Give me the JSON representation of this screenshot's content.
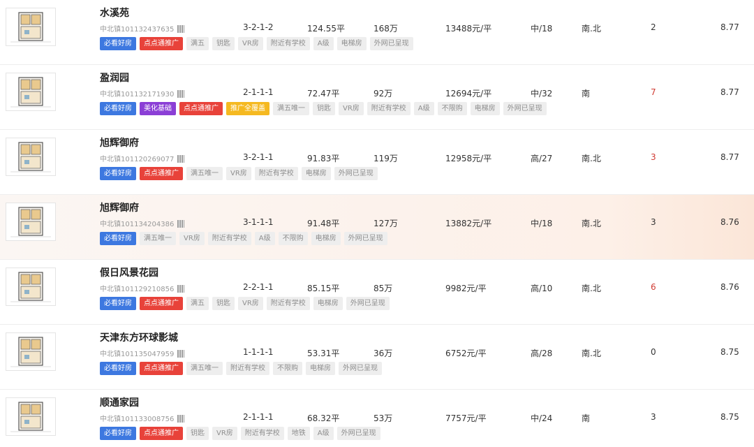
{
  "listings": [
    {
      "name": "水溪苑",
      "code": "中北镇101132437635",
      "layout": "3-2-1-2",
      "area": "124.55平",
      "total_price": "168万",
      "unit_price": "13488元/平",
      "floor": "中/18",
      "orientation": "南.北",
      "count": "2",
      "count_highlight": false,
      "score": "8.77",
      "highlighted": false,
      "tags": [
        {
          "text": "必看好房",
          "color": "blue"
        },
        {
          "text": "点点通推广",
          "color": "red"
        },
        {
          "text": "满五",
          "color": "gray"
        },
        {
          "text": "钥匙",
          "color": "gray"
        },
        {
          "text": "VR房",
          "color": "gray"
        },
        {
          "text": "附近有学校",
          "color": "gray"
        },
        {
          "text": "A级",
          "color": "gray"
        },
        {
          "text": "电梯房",
          "color": "gray"
        },
        {
          "text": "外网已呈现",
          "color": "gray"
        }
      ]
    },
    {
      "name": "盈润园",
      "code": "中北镇101132171930",
      "layout": "2-1-1-1",
      "area": "72.47平",
      "total_price": "92万",
      "unit_price": "12694元/平",
      "floor": "中/32",
      "orientation": "南",
      "count": "7",
      "count_highlight": true,
      "score": "8.77",
      "highlighted": false,
      "tags": [
        {
          "text": "必看好房",
          "color": "blue"
        },
        {
          "text": "美化基础",
          "color": "purple"
        },
        {
          "text": "点点通推广",
          "color": "red"
        },
        {
          "text": "推广全覆盖",
          "color": "yellow"
        },
        {
          "text": "满五唯一",
          "color": "gray"
        },
        {
          "text": "钥匙",
          "color": "gray"
        },
        {
          "text": "VR房",
          "color": "gray"
        },
        {
          "text": "附近有学校",
          "color": "gray"
        },
        {
          "text": "A级",
          "color": "gray"
        },
        {
          "text": "不限购",
          "color": "gray"
        },
        {
          "text": "电梯房",
          "color": "gray"
        },
        {
          "text": "外网已呈现",
          "color": "gray"
        }
      ]
    },
    {
      "name": "旭辉御府",
      "code": "中北镇101120269077",
      "layout": "3-2-1-1",
      "area": "91.83平",
      "total_price": "119万",
      "unit_price": "12958元/平",
      "floor": "高/27",
      "orientation": "南.北",
      "count": "3",
      "count_highlight": true,
      "score": "8.77",
      "highlighted": false,
      "tags": [
        {
          "text": "必看好房",
          "color": "blue"
        },
        {
          "text": "点点通推广",
          "color": "red"
        },
        {
          "text": "满五唯一",
          "color": "gray"
        },
        {
          "text": "VR房",
          "color": "gray"
        },
        {
          "text": "附近有学校",
          "color": "gray"
        },
        {
          "text": "电梯房",
          "color": "gray"
        },
        {
          "text": "外网已呈现",
          "color": "gray"
        }
      ]
    },
    {
      "name": "旭辉御府",
      "code": "中北镇101134204386",
      "layout": "3-1-1-1",
      "area": "91.48平",
      "total_price": "127万",
      "unit_price": "13882元/平",
      "floor": "中/18",
      "orientation": "南.北",
      "count": "3",
      "count_highlight": false,
      "score": "8.76",
      "highlighted": true,
      "tags": [
        {
          "text": "必看好房",
          "color": "blue"
        },
        {
          "text": "满五唯一",
          "color": "gray"
        },
        {
          "text": "VR房",
          "color": "gray"
        },
        {
          "text": "附近有学校",
          "color": "gray"
        },
        {
          "text": "A级",
          "color": "gray"
        },
        {
          "text": "不限购",
          "color": "gray"
        },
        {
          "text": "电梯房",
          "color": "gray"
        },
        {
          "text": "外网已呈现",
          "color": "gray"
        }
      ]
    },
    {
      "name": "假日风景花园",
      "code": "中北镇101129210856",
      "layout": "2-2-1-1",
      "area": "85.15平",
      "total_price": "85万",
      "unit_price": "9982元/平",
      "floor": "高/10",
      "orientation": "南.北",
      "count": "6",
      "count_highlight": true,
      "score": "8.76",
      "highlighted": false,
      "tags": [
        {
          "text": "必看好房",
          "color": "blue"
        },
        {
          "text": "点点通推广",
          "color": "red"
        },
        {
          "text": "满五",
          "color": "gray"
        },
        {
          "text": "钥匙",
          "color": "gray"
        },
        {
          "text": "VR房",
          "color": "gray"
        },
        {
          "text": "附近有学校",
          "color": "gray"
        },
        {
          "text": "电梯房",
          "color": "gray"
        },
        {
          "text": "外网已呈现",
          "color": "gray"
        }
      ]
    },
    {
      "name": "天津东方环球影城",
      "code": "中北镇101135047959",
      "layout": "1-1-1-1",
      "area": "53.31平",
      "total_price": "36万",
      "unit_price": "6752元/平",
      "floor": "高/28",
      "orientation": "南.北",
      "count": "0",
      "count_highlight": false,
      "score": "8.75",
      "highlighted": false,
      "tags": [
        {
          "text": "必看好房",
          "color": "blue"
        },
        {
          "text": "点点通推广",
          "color": "red"
        },
        {
          "text": "满五唯一",
          "color": "gray"
        },
        {
          "text": "附近有学校",
          "color": "gray"
        },
        {
          "text": "不限购",
          "color": "gray"
        },
        {
          "text": "电梯房",
          "color": "gray"
        },
        {
          "text": "外网已呈现",
          "color": "gray"
        }
      ]
    },
    {
      "name": "顺通家园",
      "code": "中北镇101133008756",
      "layout": "2-1-1-1",
      "area": "68.32平",
      "total_price": "53万",
      "unit_price": "7757元/平",
      "floor": "中/24",
      "orientation": "南",
      "count": "3",
      "count_highlight": false,
      "score": "8.75",
      "highlighted": false,
      "tags": [
        {
          "text": "必看好房",
          "color": "blue"
        },
        {
          "text": "点点通推广",
          "color": "red"
        },
        {
          "text": "钥匙",
          "color": "gray"
        },
        {
          "text": "VR房",
          "color": "gray"
        },
        {
          "text": "附近有学校",
          "color": "gray"
        },
        {
          "text": "地铁",
          "color": "gray"
        },
        {
          "text": "A级",
          "color": "gray"
        },
        {
          "text": "外网已呈现",
          "color": "gray"
        }
      ]
    }
  ],
  "colors": {
    "blue": "#3d78e0",
    "red": "#e8423a",
    "purple": "#8b3fd6",
    "yellow": "#f5b921",
    "gray_bg": "#eeeeee",
    "count_red": "#d03a32"
  }
}
